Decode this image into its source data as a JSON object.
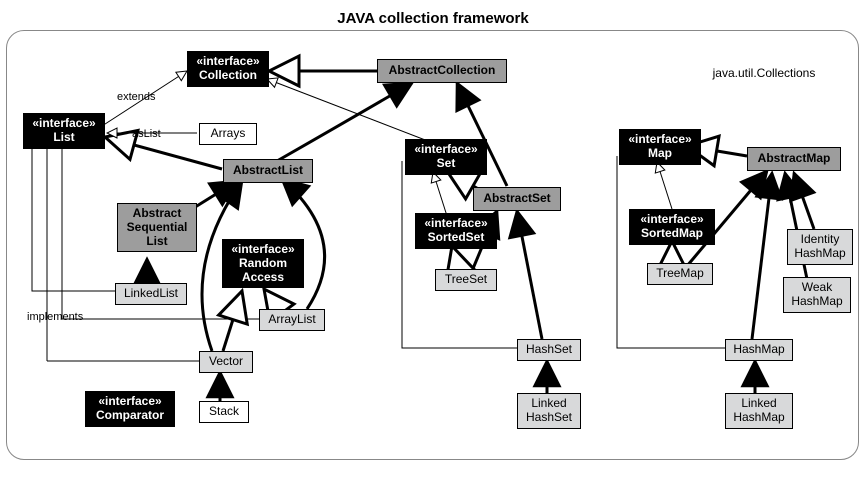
{
  "title": "JAVA collection framework",
  "labels": {
    "extends": "extends",
    "implements": "implements",
    "asList": "asList"
  },
  "nodes": {
    "collection": {
      "stereo": "«interface»",
      "name": "Collection"
    },
    "list": {
      "stereo": "«interface»",
      "name": "List"
    },
    "set": {
      "stereo": "«interface»",
      "name": "Set"
    },
    "sortedSet": {
      "stereo": "«interface»",
      "name": "SortedSet"
    },
    "map": {
      "stereo": "«interface»",
      "name": "Map"
    },
    "sortedMap": {
      "stereo": "«interface»",
      "name": "SortedMap"
    },
    "randomAccess": {
      "stereo": "«interface»",
      "name1": "Random",
      "name2": "Access"
    },
    "comparator": {
      "stereo": "«interface»",
      "name": "Comparator"
    },
    "abstractCollection": {
      "name": "AbstractCollection"
    },
    "abstractList": {
      "name": "AbstractList"
    },
    "abstractSeqList": {
      "name1": "Abstract",
      "name2": "Sequential",
      "name3": "List"
    },
    "abstractSet": {
      "name": "AbstractSet"
    },
    "abstractMap": {
      "name": "AbstractMap"
    },
    "arrays": {
      "name": "Arrays"
    },
    "collectionsUtil": {
      "name": "java.util.Collections"
    },
    "linkedList": {
      "name": "LinkedList"
    },
    "arrayList": {
      "name": "ArrayList"
    },
    "vector": {
      "name": "Vector"
    },
    "stack": {
      "name": "Stack"
    },
    "treeSet": {
      "name": "TreeSet"
    },
    "hashSet": {
      "name": "HashSet"
    },
    "linkedHashSet": {
      "name1": "Linked",
      "name2": "HashSet"
    },
    "treeMap": {
      "name": "TreeMap"
    },
    "hashMap": {
      "name": "HashMap"
    },
    "linkedHashMap": {
      "name1": "Linked",
      "name2": "HashMap"
    },
    "identityHashMap": {
      "name1": "Identity",
      "name2": "HashMap"
    },
    "weakHashMap": {
      "name1": "Weak",
      "name2": "HashMap"
    }
  }
}
